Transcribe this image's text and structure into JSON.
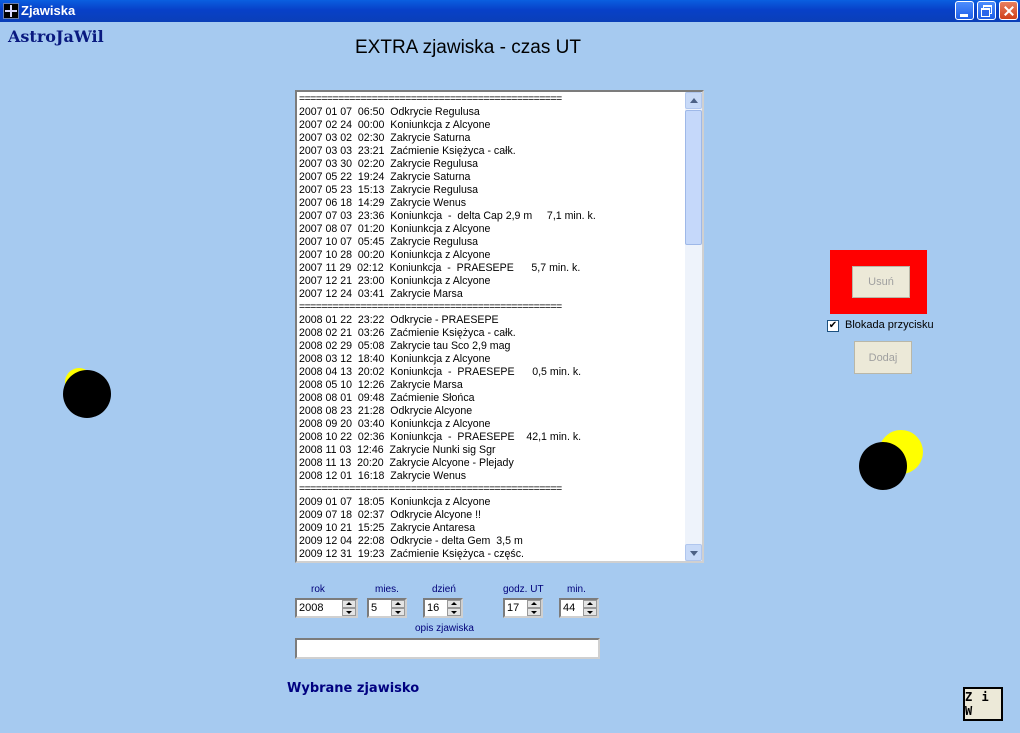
{
  "window": {
    "title": "Zjawiska"
  },
  "brand": "AstroJaWil",
  "heading": "EXTRA zjawiska - czas UT",
  "list": {
    "rows": [
      {
        "text": "===============================================",
        "sep": true
      },
      {
        "text": "2007 01 07  06:50  Odkrycie Regulusa"
      },
      {
        "text": "2007 02 24  00:00  Koniunkcja z Alcyone"
      },
      {
        "text": "2007 03 02  02:30  Zakrycie Saturna"
      },
      {
        "text": "2007 03 03  23:21  Zaćmienie Księżyca - całk."
      },
      {
        "text": "2007 03 30  02:20  Zakrycie Regulusa"
      },
      {
        "text": "2007 05 22  19:24  Zakrycie Saturna"
      },
      {
        "text": "2007 05 23  15:13  Zakrycie Regulusa"
      },
      {
        "text": "2007 06 18  14:29  Zakrycie Wenus"
      },
      {
        "text": "2007 07 03  23:36  Koniunkcja  -  delta Cap 2,9 m     7,1 min. k."
      },
      {
        "text": "2007 08 07  01:20  Koniunkcja z Alcyone"
      },
      {
        "text": "2007 10 07  05:45  Zakrycie Regulusa"
      },
      {
        "text": "2007 10 28  00:20  Koniunkcja z Alcyone"
      },
      {
        "text": "2007 11 29  02:12  Koniunkcja  -  PRAESEPE      5,7 min. k."
      },
      {
        "text": "2007 12 21  23:00  Koniunkcja z Alcyone"
      },
      {
        "text": "2007 12 24  03:41  Zakrycie Marsa"
      },
      {
        "text": "===============================================",
        "sep": true
      },
      {
        "text": "2008 01 22  23:22  Odkrycie - PRAESEPE"
      },
      {
        "text": "2008 02 21  03:26  Zaćmienie Księżyca - całk."
      },
      {
        "text": "2008 02 29  05:08  Zakrycie tau Sco 2,9 mag"
      },
      {
        "text": "2008 03 12  18:40  Koniunkcja z Alcyone"
      },
      {
        "text": "2008 04 13  20:02  Koniunkcja  -  PRAESEPE      0,5 min. k."
      },
      {
        "text": "2008 05 10  12:26  Zakrycie Marsa"
      },
      {
        "text": "2008 08 01  09:48  Zaćmienie Słońca"
      },
      {
        "text": "2008 08 23  21:28  Odkrycie Alcyone"
      },
      {
        "text": "2008 09 20  03:40  Koniunkcja z Alcyone"
      },
      {
        "text": "2008 10 22  02:36  Koniunkcja  -  PRAESEPE    42,1 min. k."
      },
      {
        "text": "2008 11 03  12:46  Zakrycie Nunki sig Sgr"
      },
      {
        "text": "2008 11 13  20:20  Zakrycie Alcyone - Plejady"
      },
      {
        "text": "2008 12 01  16:18  Zakrycie Wenus"
      },
      {
        "text": "===============================================",
        "sep": true
      },
      {
        "text": "2009 01 07  18:05  Koniunkcja z Alcyone"
      },
      {
        "text": "2009 07 18  02:37  Odkrycie Alcyone !!"
      },
      {
        "text": "2009 10 21  15:25  Zakrycie Antaresa"
      },
      {
        "text": "2009 12 04  22:08  Odkrycie - delta Gem  3,5 m"
      },
      {
        "text": "2009 12 31  19:23  Zaćmienie Księżyca - częśc."
      }
    ]
  },
  "fields": {
    "rok": {
      "label": "rok",
      "value": "2008"
    },
    "mies": {
      "label": "mies.",
      "value": "5"
    },
    "dzien": {
      "label": "dzień",
      "value": "16"
    },
    "godz": {
      "label": "godz. UT",
      "value": "17"
    },
    "min": {
      "label": "min.",
      "value": "44"
    },
    "opis": {
      "label": "opis zjawiska",
      "value": ""
    }
  },
  "selected_label": "Wybrane zjawisko",
  "buttons": {
    "usun": "Usuń",
    "blokada": "Blokada przycisku",
    "blokada_checked": true,
    "dodaj": "Dodaj",
    "ziw": "Z i W"
  }
}
